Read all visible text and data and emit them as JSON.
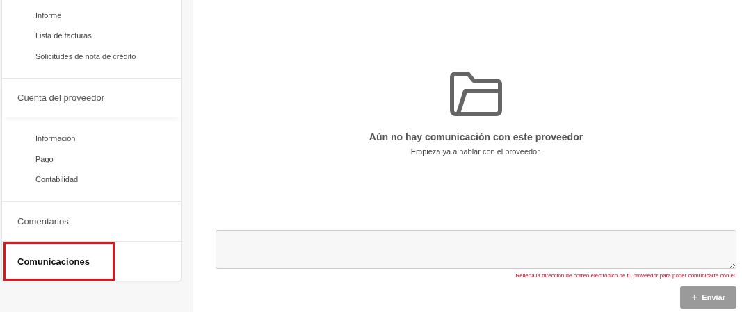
{
  "sidebar": {
    "sections": [
      {
        "items": [
          {
            "label": "Informe",
            "selected": false
          },
          {
            "label": "Lista de facturas",
            "selected": false
          },
          {
            "label": "Solicitudes de nota de crédito",
            "selected": false
          }
        ]
      },
      {
        "label": "Cuenta del proveedor",
        "selected": false,
        "items": [
          {
            "label": "Información",
            "selected": false
          },
          {
            "label": "Pago",
            "selected": false
          },
          {
            "label": "Contabilidad",
            "selected": false
          }
        ]
      },
      {
        "label": "Comentarios",
        "selected": false
      },
      {
        "label": "Comunicaciones",
        "selected": true
      }
    ]
  },
  "empty_state": {
    "title": "Aún no hay comunicación con este proveedor",
    "subtitle": "Empieza ya a hablar con el proveedor."
  },
  "message_field": {
    "error": "Rellena la dirección de correo electrónico de tu proveedor para poder comunicarte con él."
  },
  "send_button": {
    "label": "Enviar",
    "icon": "+",
    "disabled": true
  }
}
